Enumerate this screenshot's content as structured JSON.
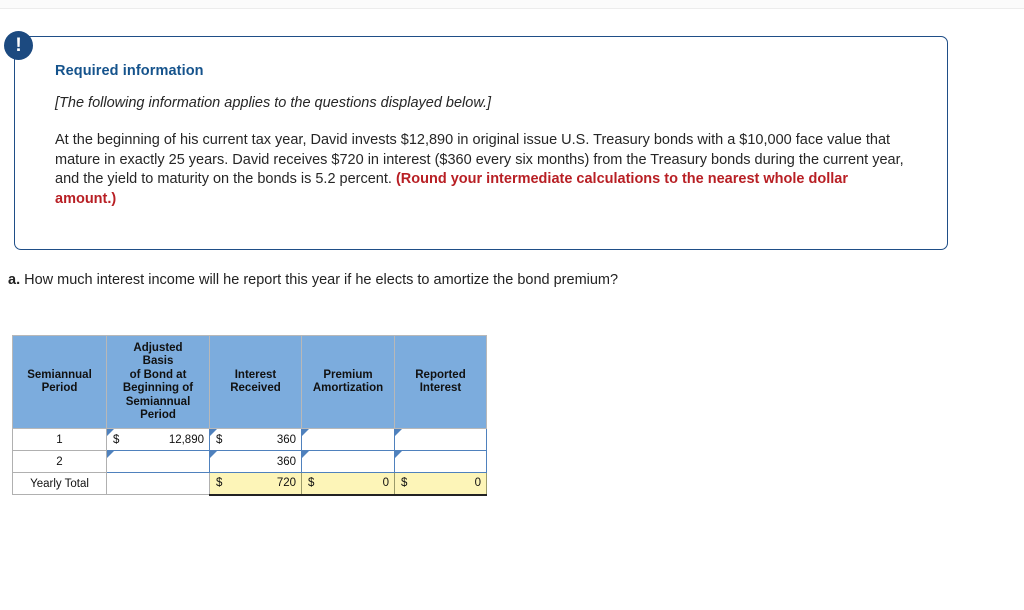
{
  "colors": {
    "panel_border": "#1f4e87",
    "heading": "#15538c",
    "alert_red": "#b81f24",
    "table_header_bg": "#7cacdd",
    "input_border": "#4f81bd",
    "total_bg": "#fdf5b8"
  },
  "alert": {
    "icon": "exclamation-icon",
    "icon_glyph": "!",
    "title": "Required information",
    "italic_note": "[The following information applies to the questions displayed below.]",
    "body_text": "At the beginning of his current tax year, David invests $12,890 in original issue U.S. Treasury bonds with a $10,000 face value that mature in exactly 25 years. David receives $720 in interest ($360 every six months) from the Treasury bonds during the current year, and the yield to maturity on the bonds is 5.2 percent. ",
    "body_emphasis": "(Round your intermediate calculations to the nearest whole dollar amount.)"
  },
  "question": {
    "label": "a.",
    "text": " How much interest income will he report this year if he elects to amortize the bond premium?"
  },
  "table": {
    "headers": [
      "Semiannual\nPeriod",
      "Adjusted\nBasis\nof Bond at\nBeginning of\nSemiannual\nPeriod",
      "Interest\nReceived",
      "Premium\nAmortization",
      "Reported\nInterest"
    ],
    "header_lines": {
      "col1": [
        "Semiannual",
        "Period"
      ],
      "col2": [
        "Adjusted",
        "Basis",
        "of Bond at",
        "Beginning of",
        "Semiannual",
        "Period"
      ],
      "col3": [
        "Interest",
        "Received"
      ],
      "col4": [
        "Premium",
        "Amortization"
      ],
      "col5": [
        "Reported",
        "Interest"
      ]
    },
    "rows": [
      {
        "period": "1",
        "adjusted_basis_symbol": "$",
        "adjusted_basis_value": "12,890",
        "interest_received_symbol": "$",
        "interest_received_value": "360",
        "premium_amortization_symbol": "",
        "premium_amortization_value": "",
        "reported_interest_symbol": "",
        "reported_interest_value": ""
      },
      {
        "period": "2",
        "adjusted_basis_symbol": "",
        "adjusted_basis_value": "",
        "interest_received_symbol": "",
        "interest_received_value": "360",
        "premium_amortization_symbol": "",
        "premium_amortization_value": "",
        "reported_interest_symbol": "",
        "reported_interest_value": ""
      }
    ],
    "total_row": {
      "label": "Yearly Total",
      "adjusted_basis_symbol": "",
      "adjusted_basis_value": "",
      "interest_received_symbol": "$",
      "interest_received_value": "720",
      "premium_amortization_symbol": "$",
      "premium_amortization_value": "0",
      "reported_interest_symbol": "$",
      "reported_interest_value": "0"
    }
  }
}
